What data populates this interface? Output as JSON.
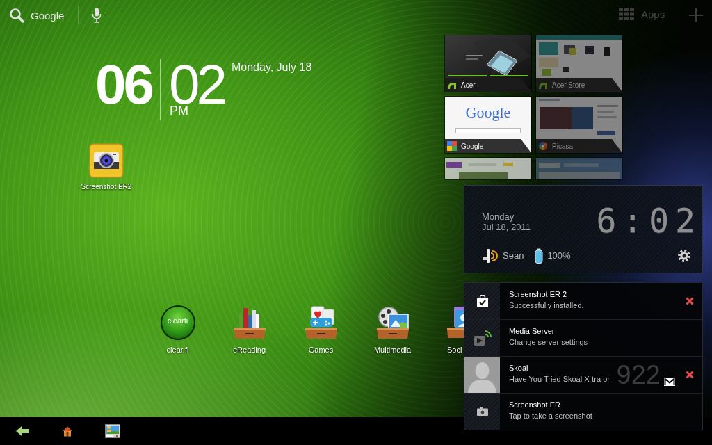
{
  "search_bar": {
    "label": "Google"
  },
  "apps_button": {
    "label": "Apps"
  },
  "clock_widget": {
    "hour": "06",
    "minute": "02",
    "period": "PM",
    "date": "Monday, July 18"
  },
  "desktop_shortcuts": [
    {
      "label": "Screenshot ER2"
    }
  ],
  "recent_apps": [
    {
      "label": "Acer",
      "kind": "acer"
    },
    {
      "label": "Acer Store",
      "kind": "store"
    },
    {
      "label": "Google",
      "kind": "google",
      "logo": "Google"
    },
    {
      "label": "Picasa",
      "kind": "picasa"
    }
  ],
  "status_panel": {
    "day": "Monday",
    "date": "Jul 18, 2011",
    "time": "6:02",
    "network": "Sean",
    "battery": "100%"
  },
  "notifications": [
    {
      "title": "Screenshot ER 2",
      "text": "Successfully installed.",
      "kind": "installed",
      "dismissible": true
    },
    {
      "title": "Media Server",
      "text": "Change server settings",
      "kind": "media",
      "dismissible": false
    },
    {
      "title": "Skoal",
      "text": "Have You Tried Skoal X-tra or",
      "kind": "gmail",
      "count": "922",
      "dismissible": true
    },
    {
      "title": "Screenshot ER",
      "text": "Tap to take a screenshot",
      "kind": "screenshot",
      "dismissible": false
    }
  ],
  "dock": [
    {
      "label": "clear.fi",
      "kind": "clearfi",
      "logo": "clearfi"
    },
    {
      "label": "eReading",
      "kind": "books"
    },
    {
      "label": "Games",
      "kind": "games"
    },
    {
      "label": "Multimedia",
      "kind": "multimedia"
    },
    {
      "label": "Soci",
      "kind": "social"
    }
  ]
}
